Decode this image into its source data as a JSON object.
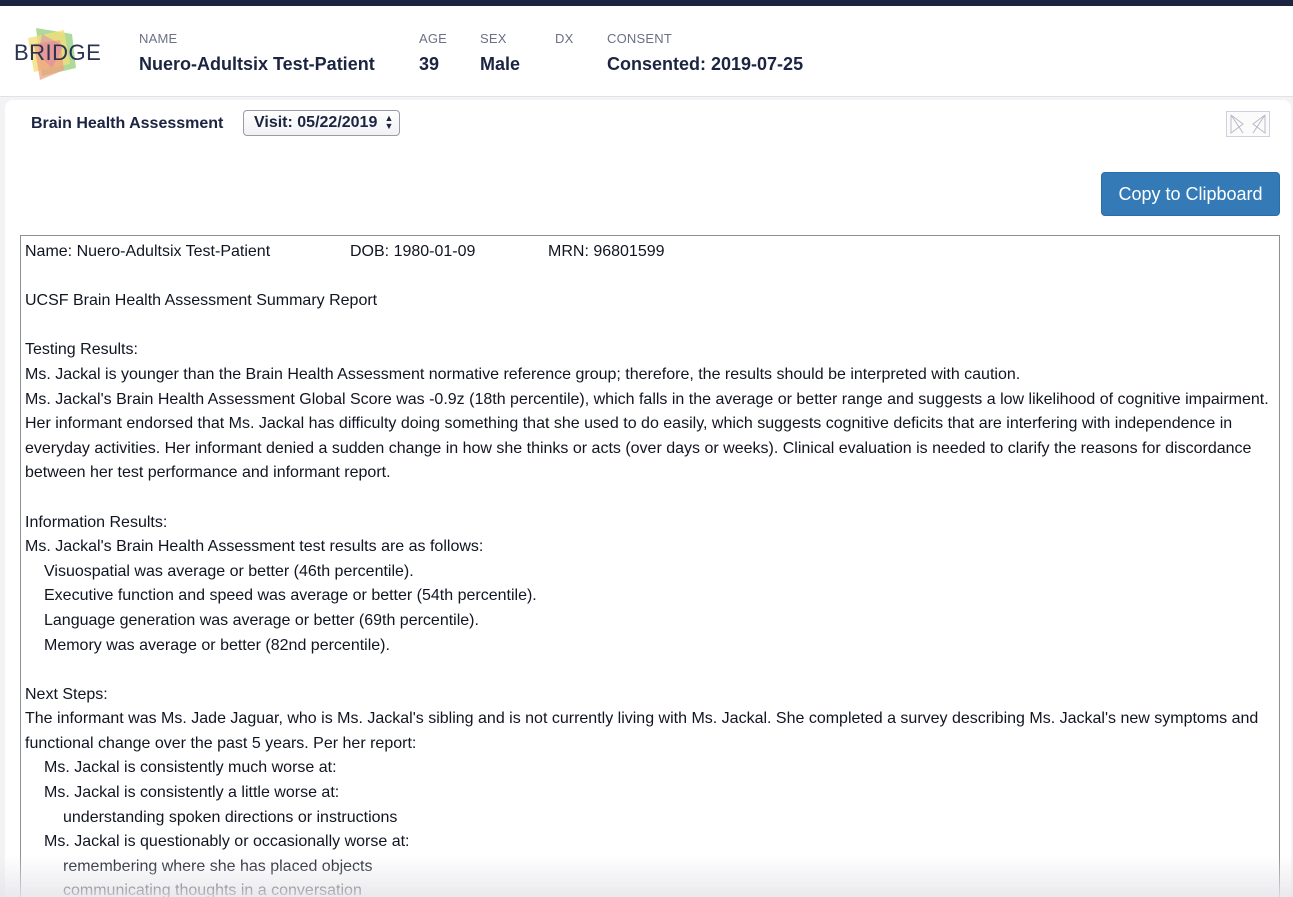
{
  "header": {
    "logo_text": "BRIDGE",
    "name_label": "NAME",
    "name_value": "Nuero-Adultsix Test-Patient",
    "age_label": "AGE",
    "age_value": "39",
    "sex_label": "SEX",
    "sex_value": "Male",
    "dx_label": "DX",
    "dx_value": "",
    "consent_label": "CONSENT",
    "consent_value": "Consented: 2019-07-25"
  },
  "panel": {
    "title": "Brain Health Assessment",
    "visit_selected": "Visit: 05/22/2019",
    "copy_button": "Copy to Clipboard"
  },
  "report": {
    "id_name": "Name: Nuero-Adultsix Test-Patient",
    "id_dob": "DOB: 1980-01-09",
    "id_mrn": "MRN: 96801599",
    "title": "UCSF Brain Health Assessment Summary Report",
    "testing_heading": "Testing Results:",
    "testing_p1": "Ms. Jackal is younger than the Brain Health Assessment normative reference group; therefore, the results should be interpreted with caution.",
    "testing_p2": "Ms. Jackal's Brain Health Assessment Global Score was -0.9z (18th percentile), which falls in the average or better range and suggests a low likelihood of cognitive impairment. Her informant endorsed that Ms. Jackal has difficulty doing something that she used to do easily, which suggests cognitive deficits that are interfering with independence in everyday activities. Her informant denied a sudden change in how she thinks or acts (over days or weeks). Clinical evaluation is needed to clarify the reasons for discordance between her test performance and informant report.",
    "info_heading": "Information Results:",
    "info_intro": "Ms. Jackal's Brain Health Assessment test results are as follows:",
    "info_items": [
      "Visuospatial was average or better (46th percentile).",
      "Executive function and speed was average or better (54th percentile).",
      "Language generation was average or better (69th percentile).",
      "Memory was average or better (82nd percentile)."
    ],
    "next_heading": "Next Steps:",
    "next_p1": "The informant was Ms. Jade Jaguar, who is Ms. Jackal's sibling and is not currently living with Ms. Jackal. She completed a survey describing Ms. Jackal's new symptoms and functional change over the past 5 years. Per her report:",
    "much_worse": "Ms. Jackal is consistently much worse at:",
    "little_worse": "Ms. Jackal is consistently a little worse at:",
    "little_worse_items": [
      "understanding spoken directions or instructions"
    ],
    "occasional_worse": "Ms. Jackal is questionably or occasionally worse at:",
    "occasional_items": [
      "remembering where she has placed objects",
      "communicating thoughts in a conversation"
    ]
  }
}
